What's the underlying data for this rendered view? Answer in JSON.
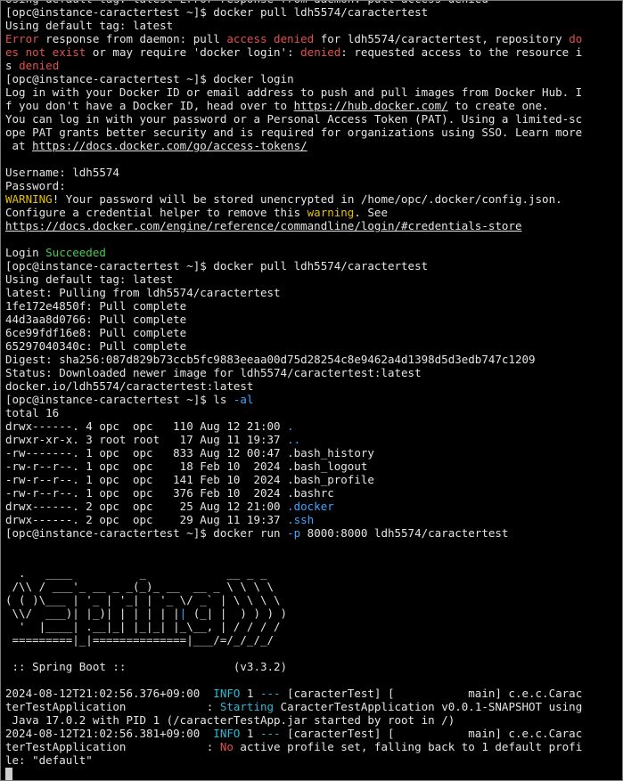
{
  "colors": {
    "background": "#000000",
    "text": "#e5e5e5",
    "error": "#e05050",
    "success": "#4ec94e",
    "warning": "#e5c100",
    "directory": "#3ea4ff",
    "info": "#2fb8d6"
  },
  "terminal": {
    "lines": [
      [
        {
          "t": "Using default tag: latest Error response from daemon: pull access denied"
        }
      ],
      [
        {
          "t": "[opc@instance-caractertest ~]$ docker pull ldh5574/caractertest"
        }
      ],
      [
        {
          "t": "Using default tag: latest"
        }
      ],
      [
        {
          "t": "Error",
          "c": "red"
        },
        {
          "t": " response from daemon: pull "
        },
        {
          "t": "access denied",
          "c": "red"
        },
        {
          "t": " for ldh5574/caractertest, repository "
        },
        {
          "t": "do",
          "c": "red"
        }
      ],
      [
        {
          "t": "es not exist",
          "c": "red"
        },
        {
          "t": " or may require 'docker login': "
        },
        {
          "t": "denied",
          "c": "red"
        },
        {
          "t": ": requested access to the resource i"
        }
      ],
      [
        {
          "t": "s "
        },
        {
          "t": "denied",
          "c": "red"
        }
      ],
      [
        {
          "t": "[opc@instance-caractertest ~]$ docker login"
        }
      ],
      [
        {
          "t": "Log in with your Docker ID or email address to push and pull images from Docker Hub. I"
        }
      ],
      [
        {
          "t": "f you don't have a Docker ID, head over to "
        },
        {
          "t": "https://hub.docker.com/",
          "c": "link"
        },
        {
          "t": " to create one."
        }
      ],
      [
        {
          "t": "You can log in with your password or a Personal Access Token (PAT). Using a limited-sc"
        }
      ],
      [
        {
          "t": "ope PAT grants better security and is required for organizations using SSO. Learn more"
        }
      ],
      [
        {
          "t": " at "
        },
        {
          "t": "https://docs.docker.com/go/access-tokens/",
          "c": "link"
        }
      ],
      [
        {
          "t": ""
        }
      ],
      [
        {
          "t": "Username: ldh5574"
        }
      ],
      [
        {
          "t": "Password:"
        }
      ],
      [
        {
          "t": "WARNING",
          "c": "yellow"
        },
        {
          "t": "! Your password will be stored unencrypted in /home/opc/.docker/config.json."
        }
      ],
      [
        {
          "t": "Configure a credential helper to remove this "
        },
        {
          "t": "warning",
          "c": "yellow"
        },
        {
          "t": ". See"
        }
      ],
      [
        {
          "t": "https://docs.docker.com/engine/reference/commandline/login/#credentials-store",
          "c": "link"
        }
      ],
      [
        {
          "t": ""
        }
      ],
      [
        {
          "t": "Login "
        },
        {
          "t": "Succeeded",
          "c": "green"
        }
      ],
      [
        {
          "t": "[opc@instance-caractertest ~]$ docker pull ldh5574/caractertest"
        }
      ],
      [
        {
          "t": "Using default tag: latest"
        }
      ],
      [
        {
          "t": "latest: Pulling from ldh5574/caractertest"
        }
      ],
      [
        {
          "t": "1fe172e4850f: Pull complete"
        }
      ],
      [
        {
          "t": "44d3aa8d0766: Pull complete"
        }
      ],
      [
        {
          "t": "6ce99fdf16e8: Pull complete"
        }
      ],
      [
        {
          "t": "65297040340c: Pull complete"
        }
      ],
      [
        {
          "t": "Digest: sha256:087d829b73ccb5fc9883eeaa00d75d28254c8e9462a4d1398d5d3edb747c1209"
        }
      ],
      [
        {
          "t": "Status: Downloaded newer image for ldh5574/caractertest:latest"
        }
      ],
      [
        {
          "t": "docker.io/ldh5574/caractertest:latest"
        }
      ],
      [
        {
          "t": "[opc@instance-caractertest ~]$ ls "
        },
        {
          "t": "-al",
          "c": "blue"
        }
      ],
      [
        {
          "t": "total 16"
        }
      ],
      [
        {
          "t": "drwx------. 4 opc  opc   110 Aug 12 21:00 "
        },
        {
          "t": ".",
          "c": "blue"
        }
      ],
      [
        {
          "t": "drwxr-xr-x. 3 root root   17 Aug 11 19:37 "
        },
        {
          "t": "..",
          "c": "blue"
        }
      ],
      [
        {
          "t": "-rw-------. 1 opc  opc   833 Aug 12 00:47 .bash_history"
        }
      ],
      [
        {
          "t": "-rw-r--r--. 1 opc  opc    18 Feb 10  2024 .bash_logout"
        }
      ],
      [
        {
          "t": "-rw-r--r--. 1 opc  opc   141 Feb 10  2024 .bash_profile"
        }
      ],
      [
        {
          "t": "-rw-r--r--. 1 opc  opc   376 Feb 10  2024 .bashrc"
        }
      ],
      [
        {
          "t": "drwx------. 2 opc  opc    25 Aug 12 21:00 "
        },
        {
          "t": ".docker",
          "c": "blue"
        }
      ],
      [
        {
          "t": "drwx------. 2 opc  opc    29 Aug 11 19:37 "
        },
        {
          "t": ".ssh",
          "c": "blue"
        }
      ],
      [
        {
          "t": "[opc@instance-caractertest ~]$ docker run "
        },
        {
          "t": "-p",
          "c": "blue"
        },
        {
          "t": " 8000:8000 ldh5574/caractertest"
        }
      ],
      [
        {
          "t": ""
        }
      ],
      [
        {
          "t": ""
        }
      ],
      [
        {
          "t": "  .   ____          _            __ _ _"
        }
      ],
      [
        {
          "t": " /\\\\ / ___'_ __ _ _(_)_ __  __ _ \\ \\ \\ \\"
        }
      ],
      [
        {
          "t": "( ( )\\___ | '_ | '_| | '_ \\/ _` | \\ \\ \\ \\"
        }
      ],
      [
        {
          "t": " \\\\/  ___)| |_)| | | | | |"
        },
        {
          "t": "|",
          "c": "blue"
        },
        {
          "t": " (_| |  ) ) ) )"
        }
      ],
      [
        {
          "t": "  '  |____| .__|_| |_|_| |_\\__, | / / / /"
        }
      ],
      [
        {
          "t": " =========|_|==============|___/=/_/_/_/"
        }
      ],
      [
        {
          "t": ""
        }
      ],
      [
        {
          "t": " :: Spring Boot ::                (v3.3.2)"
        }
      ],
      [
        {
          "t": ""
        }
      ],
      [
        {
          "t": "2024-08-12T21:02:56.376+09:00  "
        },
        {
          "t": "INFO",
          "c": "cyan"
        },
        {
          "t": " 1 "
        },
        {
          "t": "---",
          "c": "cyan"
        },
        {
          "t": " [caracterTest] [           main] c.e.c.Carac"
        }
      ],
      [
        {
          "t": "terTestApplication            : "
        },
        {
          "t": "Starting",
          "c": "cyan"
        },
        {
          "t": " CaracterTestApplication v0.0.1-SNAPSHOT using"
        }
      ],
      [
        {
          "t": " Java 17.0.2 with PID 1 (/caracterTestApp.jar started by root in /)"
        }
      ],
      [
        {
          "t": "2024-08-12T21:02:56.381+09:00  "
        },
        {
          "t": "INFO",
          "c": "cyan"
        },
        {
          "t": " 1 "
        },
        {
          "t": "---",
          "c": "cyan"
        },
        {
          "t": " [caracterTest] [           main] c.e.c.Carac"
        }
      ],
      [
        {
          "t": "terTestApplication            : "
        },
        {
          "t": "No",
          "c": "red"
        },
        {
          "t": " active profile set, falling back to 1 default profi"
        }
      ],
      [
        {
          "t": "le: \"default\""
        }
      ]
    ]
  }
}
